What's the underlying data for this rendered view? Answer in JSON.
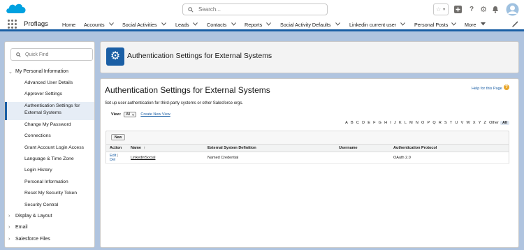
{
  "header": {
    "search_placeholder": "Search...",
    "icons": [
      "favorites-star-icon",
      "add-icon",
      "help-icon",
      "setup-gear-icon",
      "notifications-bell-icon",
      "user-avatar-icon"
    ]
  },
  "nav": {
    "app_name": "Proflags",
    "items": [
      {
        "label": "Home"
      },
      {
        "label": "Accounts"
      },
      {
        "label": "Social Activities"
      },
      {
        "label": "Leads"
      },
      {
        "label": "Contacts"
      },
      {
        "label": "Reports"
      },
      {
        "label": "Social Activity Defaults"
      },
      {
        "label": "Linkedin current user"
      },
      {
        "label": "Personal Posts"
      },
      {
        "label": "More"
      }
    ]
  },
  "sidebar": {
    "quickfind_placeholder": "Quick Find",
    "section": "My Personal Information",
    "items": [
      {
        "label": "Advanced User Details"
      },
      {
        "label": "Approver Settings"
      },
      {
        "label": "Authentication Settings for"
      },
      {
        "label": "External Systems"
      },
      {
        "label": "Change My Password"
      },
      {
        "label": "Connections"
      },
      {
        "label": "Grant Account Login Access"
      },
      {
        "label": "Language & Time Zone"
      },
      {
        "label": "Login History"
      },
      {
        "label": "Personal Information"
      },
      {
        "label": "Reset My Security Token"
      },
      {
        "label": "Security Central"
      }
    ],
    "collapsed": [
      {
        "label": "Display & Layout"
      },
      {
        "label": "Email"
      },
      {
        "label": "Salesforce Files"
      }
    ]
  },
  "page_header": {
    "title": "Authentication Settings for External Systems"
  },
  "main": {
    "title": "Authentication Settings for External Systems",
    "help_link": "Help for this Page",
    "description": "Set up user authentication for third-party systems or other Salesforce orgs.",
    "view_label": "View:",
    "view_value": "All",
    "create_view": "Create New View",
    "alphabet": [
      "A",
      "B",
      "C",
      "D",
      "E",
      "F",
      "G",
      "H",
      "I",
      "J",
      "K",
      "L",
      "M",
      "N",
      "O",
      "P",
      "Q",
      "R",
      "S",
      "T",
      "U",
      "V",
      "W",
      "X",
      "Y",
      "Z",
      "Other",
      "All"
    ],
    "new_button": "New",
    "table": {
      "headers": [
        "Action",
        "Name",
        "External System Definition",
        "Username",
        "Authentication Protocol"
      ],
      "sort_indicator": "↑",
      "rows": [
        {
          "edit": "Edit",
          "sep": "|",
          "del": "Del",
          "name": "LinkedinSocial",
          "definition": "Named Credential",
          "username": "",
          "protocol": "OAuth 2.0"
        }
      ]
    }
  }
}
